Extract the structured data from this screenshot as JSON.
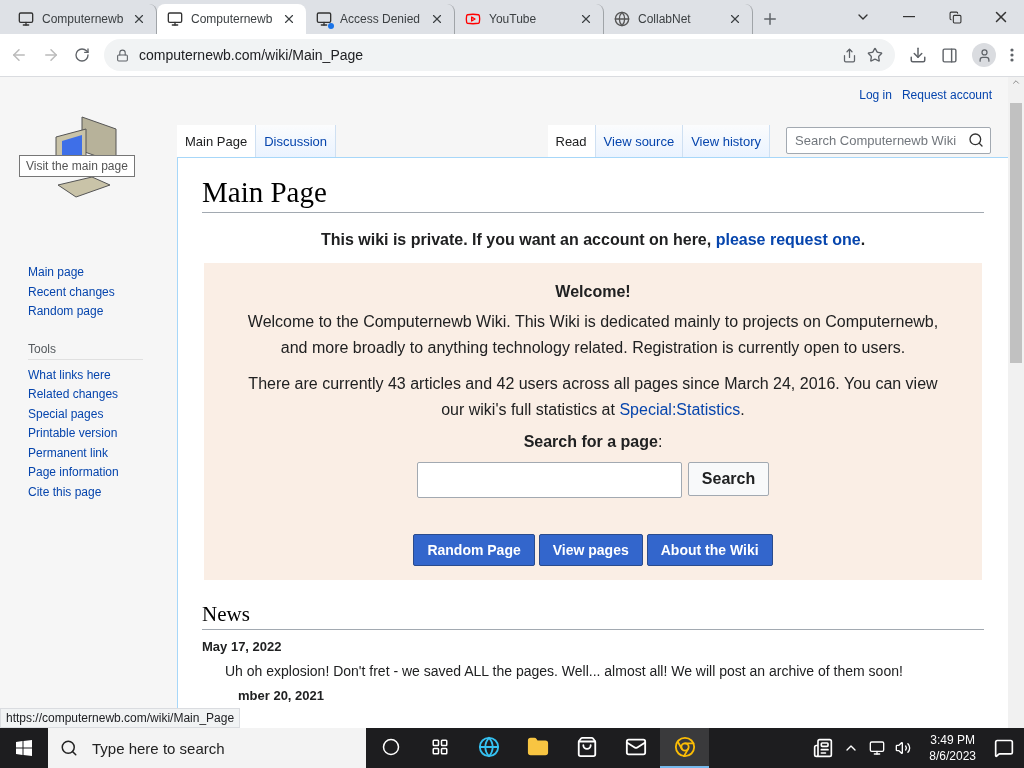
{
  "browser": {
    "tabs": [
      {
        "title": "Computernewb",
        "kind": "computer",
        "selected": false,
        "dot": false
      },
      {
        "title": "Computernewb",
        "kind": "computer",
        "selected": true,
        "dot": false
      },
      {
        "title": "Access Denied",
        "kind": "computer",
        "selected": false,
        "dot": true
      },
      {
        "title": "YouTube",
        "kind": "youtube",
        "selected": false,
        "dot": false
      },
      {
        "title": "CollabNet",
        "kind": "globe",
        "selected": false,
        "dot": false
      }
    ],
    "address": "computernewb.com/wiki/Main_Page",
    "status_link": "https://computernewb.com/wiki/Main_Page"
  },
  "wiki": {
    "logo_tooltip": "Visit the main page",
    "personal_links": [
      "Log in",
      "Request account"
    ],
    "page_tabs": [
      {
        "label": "Main Page",
        "selected": true
      },
      {
        "label": "Discussion",
        "selected": false
      }
    ],
    "view_tabs": [
      {
        "label": "Read",
        "selected": true
      },
      {
        "label": "View source",
        "selected": false
      },
      {
        "label": "View history",
        "selected": false
      }
    ],
    "search": {
      "placeholder": "Search Computernewb Wiki"
    },
    "navigation": [
      "Main page",
      "Recent changes",
      "Random page"
    ],
    "tools": {
      "heading": "Tools",
      "items": [
        "What links here",
        "Related changes",
        "Special pages",
        "Printable version",
        "Permanent link",
        "Page information",
        "Cite this page"
      ]
    },
    "title": "Main Page",
    "notice": {
      "text": "This wiki is private. If you want an account on here,",
      "link": "please request one",
      "end": "."
    },
    "welcome": {
      "heading": "Welcome!",
      "intro": "Welcome to the Computernewb Wiki. This Wiki is dedicated mainly to projects on Computernewb, and more broadly to anything technology related. Registration is currently open to users.",
      "stats": "There are currently 43 articles and 42 users across all pages since March 24, 2016. You can view our wiki's full statistics at",
      "stats_link": "Special:Statistics",
      "stats_end": ".",
      "search_label": "Search for a page",
      "search_label_end": ":",
      "search_button": "Search",
      "buttons": [
        "Random Page",
        "View pages",
        "About the Wiki"
      ]
    },
    "news": {
      "heading": "News",
      "items": [
        {
          "date": "May 17, 2022",
          "text": "Uh oh explosion! Don't fret - we saved ALL the pages. Well... almost all! We will post an archive of them soon!"
        },
        {
          "date": "mber 20, 2021"
        }
      ]
    }
  },
  "taskbar": {
    "search_placeholder": "Type here to search",
    "apps": [
      {
        "kind": "cortana",
        "selected": false
      },
      {
        "kind": "taskview",
        "selected": false
      },
      {
        "kind": "edge",
        "selected": false
      },
      {
        "kind": "explorer",
        "selected": false
      },
      {
        "kind": "store",
        "selected": false
      },
      {
        "kind": "mail",
        "selected": false
      },
      {
        "kind": "chrome",
        "selected": true
      }
    ],
    "time": "3:49 PM",
    "date": "8/6/2023"
  }
}
